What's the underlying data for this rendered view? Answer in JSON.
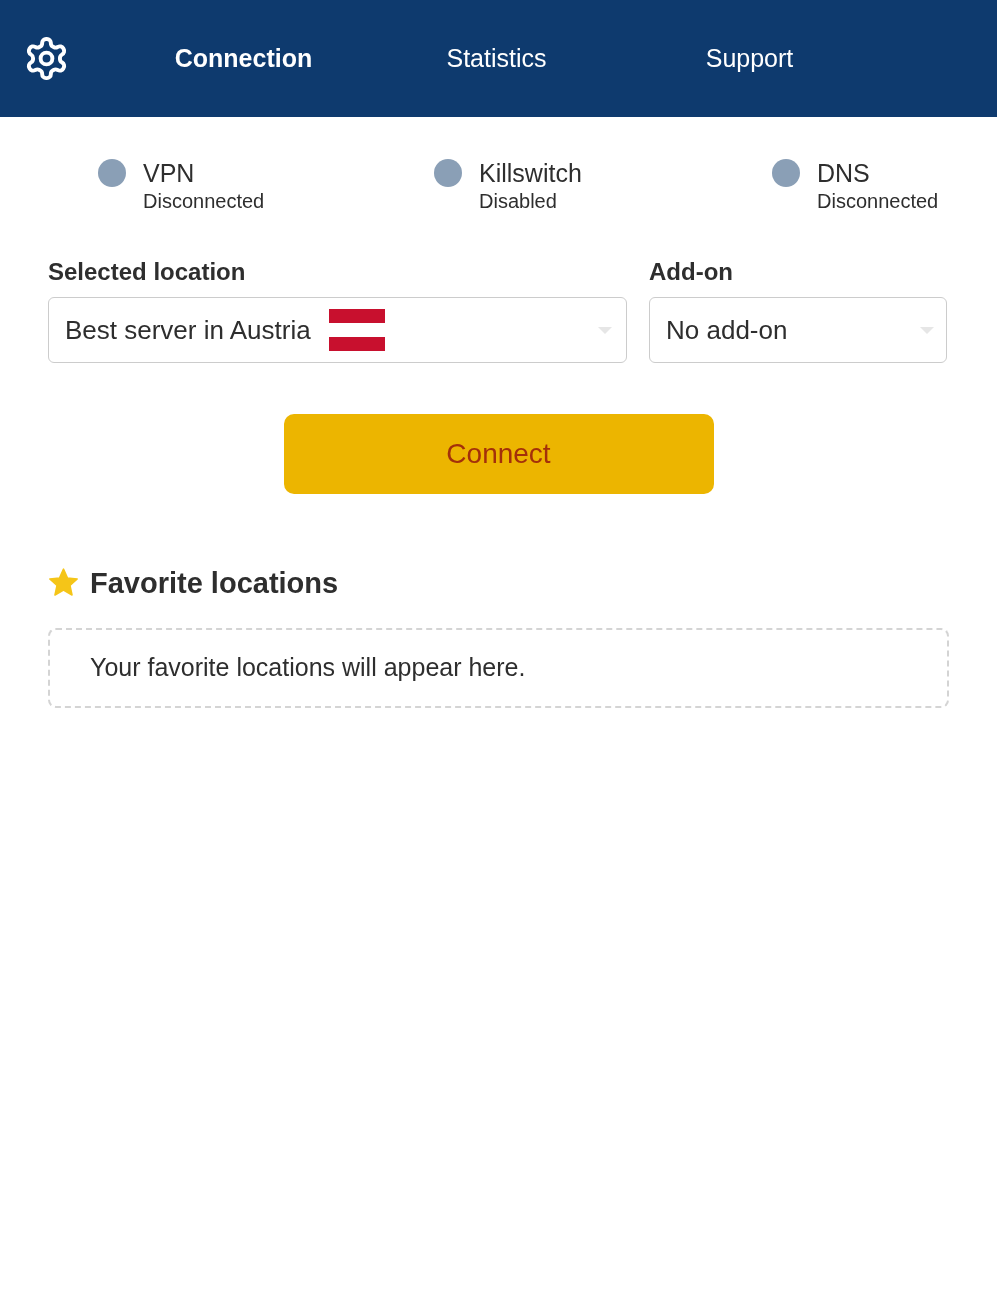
{
  "header": {
    "tabs": [
      {
        "label": "Connection",
        "selected": true
      },
      {
        "label": "Statistics",
        "selected": false
      },
      {
        "label": "Support",
        "selected": false
      }
    ]
  },
  "statuses": [
    {
      "name": "VPN",
      "value": "Disconnected",
      "color": "#8a9fb6"
    },
    {
      "name": "Killswitch",
      "value": "Disabled",
      "color": "#8a9fb6"
    },
    {
      "name": "DNS",
      "value": "Disconnected",
      "color": "#8a9fb6"
    }
  ],
  "location": {
    "label": "Selected location",
    "value": "Best server in Austria"
  },
  "addon": {
    "label": "Add-on",
    "value": "No add-on"
  },
  "connect_button": {
    "label": "Connect"
  },
  "favorites": {
    "title": "Favorite locations",
    "empty_message": "Your favorite locations will appear here."
  }
}
